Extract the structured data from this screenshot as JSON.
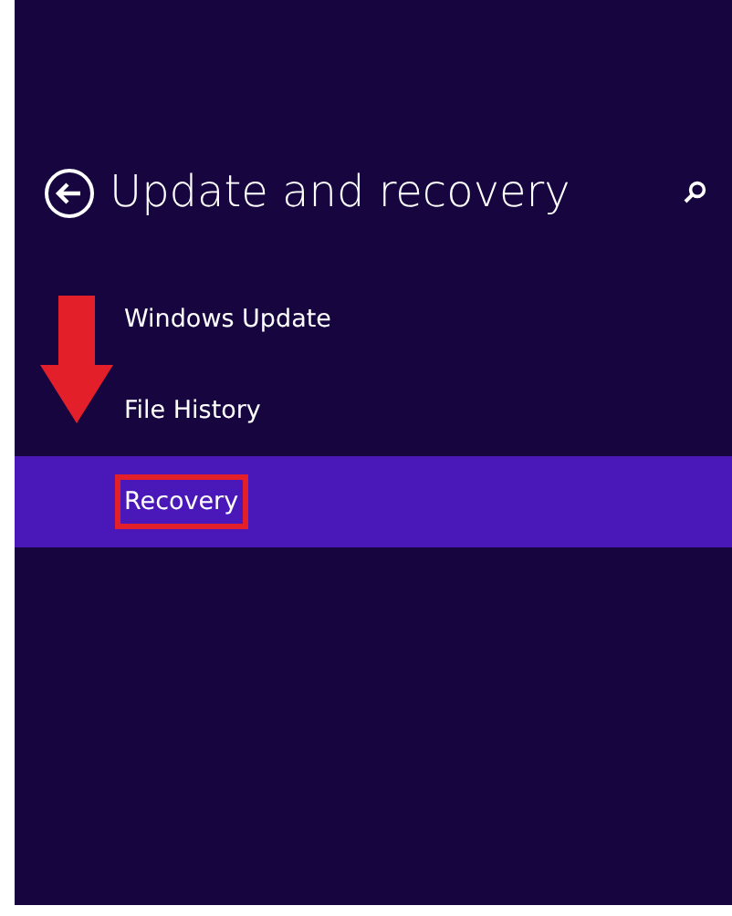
{
  "header": {
    "title": "Update and recovery"
  },
  "menu": [
    {
      "label": "Windows Update",
      "selected": false,
      "highlighted": false
    },
    {
      "label": "File History",
      "selected": false,
      "highlighted": false
    },
    {
      "label": "Recovery",
      "selected": true,
      "highlighted": true
    }
  ]
}
